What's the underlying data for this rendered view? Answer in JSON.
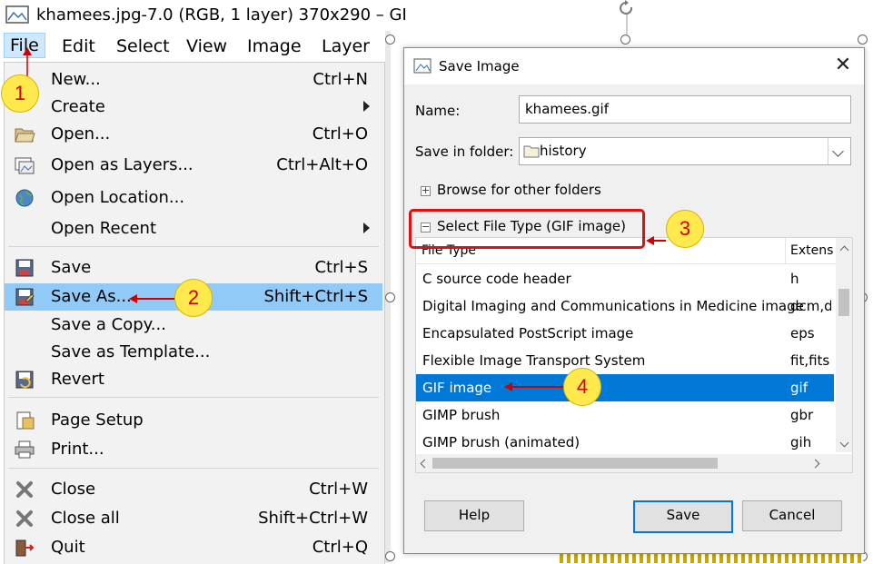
{
  "window": {
    "title": "khamees.jpg-7.0 (RGB, 1 layer) 370x290 – GI"
  },
  "menubar": [
    "File",
    "Edit",
    "Select",
    "View",
    "Image",
    "Layer"
  ],
  "file_menu": {
    "new": {
      "label": "New...",
      "shortcut": "Ctrl+N"
    },
    "create": {
      "label": "Create"
    },
    "open": {
      "label": "Open...",
      "shortcut": "Ctrl+O"
    },
    "open_as_layers": {
      "label": "Open as Layers...",
      "shortcut": "Ctrl+Alt+O"
    },
    "open_location": {
      "label": "Open Location..."
    },
    "open_recent": {
      "label": "Open Recent"
    },
    "save": {
      "label": "Save",
      "shortcut": "Ctrl+S"
    },
    "save_as": {
      "label": "Save As...",
      "shortcut": "Shift+Ctrl+S"
    },
    "save_copy": {
      "label": "Save a Copy..."
    },
    "save_template": {
      "label": "Save as Template..."
    },
    "revert": {
      "label": "Revert"
    },
    "page_setup": {
      "label": "Page Setup"
    },
    "print": {
      "label": "Print..."
    },
    "close": {
      "label": "Close",
      "shortcut": "Ctrl+W"
    },
    "close_all": {
      "label": "Close all",
      "shortcut": "Shift+Ctrl+W"
    },
    "quit": {
      "label": "Quit",
      "shortcut": "Ctrl+Q"
    }
  },
  "dialog": {
    "title": "Save Image",
    "close_glyph": "✕",
    "name_label": "Name:",
    "name_value": "khamees.gif",
    "folder_label": "Save in folder:",
    "folder_value": "history",
    "browse_label": "Browse for other folders",
    "filetype_label": "Select File Type (GIF image)",
    "expander_plus": "+",
    "expander_minus": "−",
    "columns": [
      "File Type",
      "Extens"
    ],
    "rows": [
      {
        "type": "C source code header",
        "ext": "h"
      },
      {
        "type": "Digital Imaging and Communications in Medicine image",
        "ext": "dcm,d"
      },
      {
        "type": "Encapsulated PostScript image",
        "ext": "eps"
      },
      {
        "type": "Flexible Image Transport System",
        "ext": "fit,fits"
      },
      {
        "type": "GIF image",
        "ext": "gif"
      },
      {
        "type": "GIMP brush",
        "ext": "gbr"
      },
      {
        "type": "GIMP brush (animated)",
        "ext": "gih"
      }
    ],
    "selected_row": "GIF image",
    "buttons": {
      "help": "Help",
      "save": "Save",
      "cancel": "Cancel"
    }
  },
  "annotations": [
    "1",
    "2",
    "3",
    "4"
  ],
  "colors": {
    "selection": "#0078d7",
    "menu_highlight": "#91c9f7",
    "annotation_fill": "#ffe94d",
    "annotation_red": "#e01010"
  }
}
